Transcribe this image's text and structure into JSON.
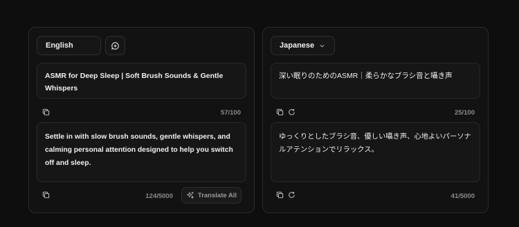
{
  "source": {
    "language": "English",
    "title": "ASMR for Deep Sleep | Soft Brush Sounds & Gentle Whispers",
    "title_count": "57/100",
    "description": "Settle in with slow brush sounds, gentle whispers, and calming personal attention designed to help you switch off and sleep.",
    "description_count": "124/5000",
    "translate_all_label": "Translate All"
  },
  "target": {
    "language": "Japanese",
    "title": "深い眠りのためのASMR｜柔らかなブラシ音と囁き声",
    "title_count": "25/100",
    "description": "ゆっくりとしたブラシ音、優しい囁き声、心地よいパーソナルアテンションでリラックス。",
    "description_count": "41/5000"
  },
  "icons": {
    "swap": "chat-plus-icon",
    "copy": "copy-icon",
    "regenerate": "refresh-icon",
    "sparkle": "sparkle-icon",
    "chevron": "chevron-down-icon"
  }
}
